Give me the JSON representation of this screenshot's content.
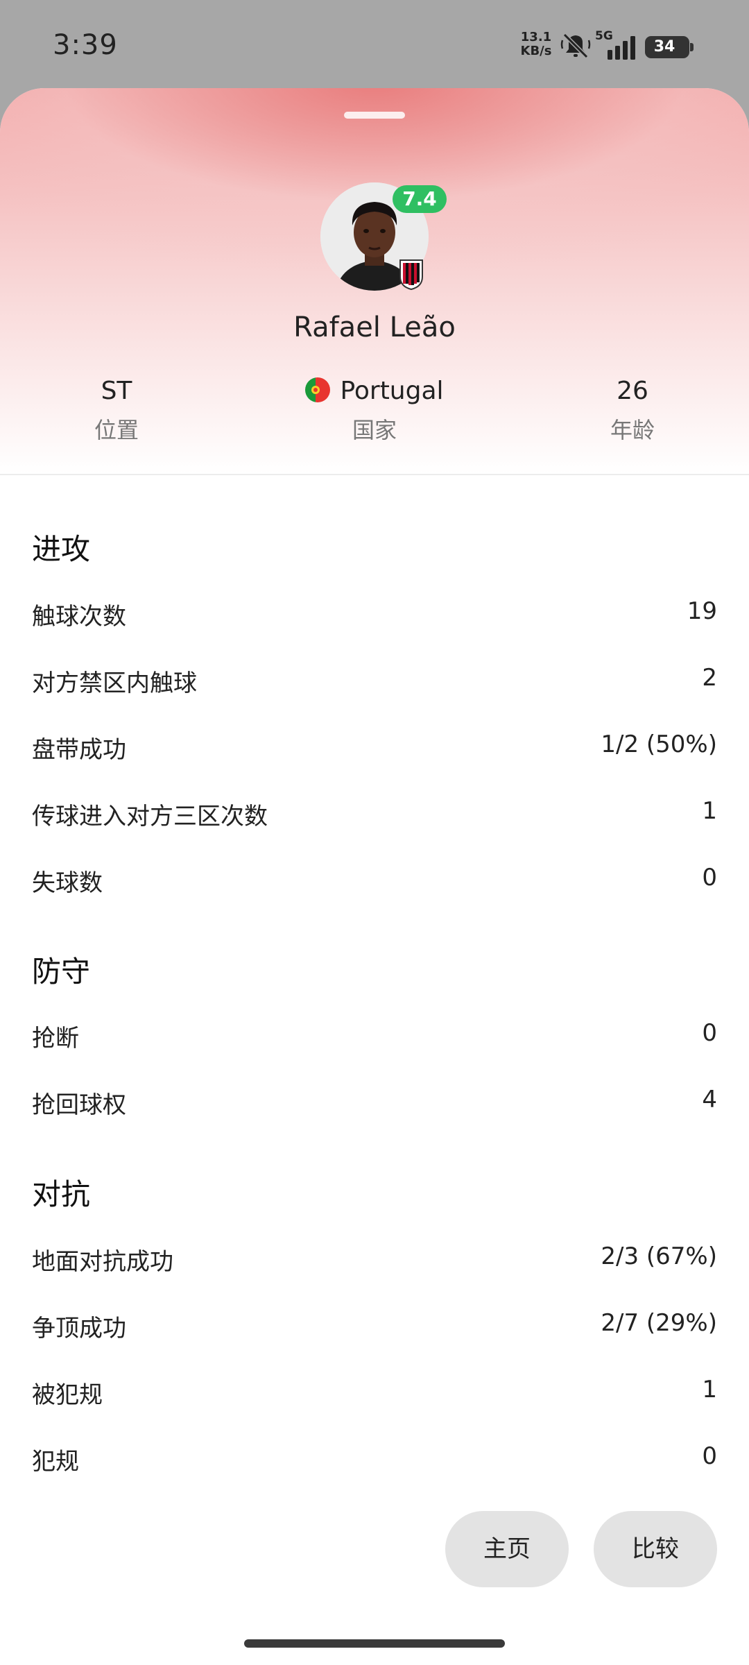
{
  "status_bar": {
    "time": "3:39",
    "net_speed_value": "13.1",
    "net_speed_unit": "KB/s",
    "network": "5G",
    "battery": "34"
  },
  "player": {
    "name": "Rafael Leão",
    "rating": "7.4",
    "rating_color": "#2fbf62"
  },
  "info": {
    "position_value": "ST",
    "position_label": "位置",
    "country_value": "Portugal",
    "country_label": "国家",
    "age_value": "26",
    "age_label": "年龄"
  },
  "sections": {
    "attack": {
      "title": "进攻",
      "rows": [
        {
          "label": "触球次数",
          "value": "19"
        },
        {
          "label": "对方禁区内触球",
          "value": "2"
        },
        {
          "label": "盘带成功",
          "value": "1/2 (50%)"
        },
        {
          "label": "传球进入对方三区次数",
          "value": "1"
        },
        {
          "label": "失球数",
          "value": "0"
        }
      ]
    },
    "defense": {
      "title": "防守",
      "rows": [
        {
          "label": "抢断",
          "value": "0"
        },
        {
          "label": "抢回球权",
          "value": "4"
        }
      ]
    },
    "duels": {
      "title": "对抗",
      "rows": [
        {
          "label": "地面对抗成功",
          "value": "2/3 (67%)"
        },
        {
          "label": "争顶成功",
          "value": "2/7 (29%)"
        },
        {
          "label": "被犯规",
          "value": "1"
        },
        {
          "label": "犯规",
          "value": "0"
        }
      ]
    }
  },
  "buttons": {
    "home": "主页",
    "compare": "比较"
  },
  "icons": {
    "mute": "bell-off-icon",
    "signal": "signal-icon",
    "battery": "battery-icon",
    "flag": "portugal-flag-icon",
    "club": "ac-milan-crest-icon"
  }
}
